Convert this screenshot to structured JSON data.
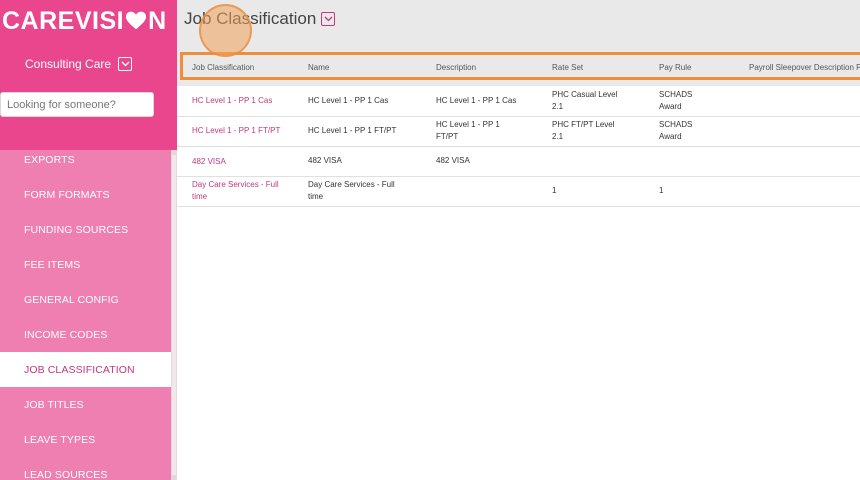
{
  "brand": {
    "logo_prefix": "CAREVISI",
    "logo_suffix": "N",
    "accent": "#e9468e",
    "link": "#c2387a",
    "highlight": "#ee8e3a"
  },
  "sidebar": {
    "org_name": "Consulting Care",
    "search_placeholder": "Looking for someone?",
    "items": [
      {
        "label": "EXPORTS"
      },
      {
        "label": "FORM FORMATS"
      },
      {
        "label": "FUNDING SOURCES"
      },
      {
        "label": "FEE ITEMS"
      },
      {
        "label": "GENERAL CONFIG"
      },
      {
        "label": "INCOME CODES"
      },
      {
        "label": "JOB CLASSIFICATION",
        "active": true
      },
      {
        "label": "JOB TITLES"
      },
      {
        "label": "LEAVE TYPES"
      },
      {
        "label": "LEAD SOURCES"
      }
    ]
  },
  "page": {
    "title": "Job Classification"
  },
  "table": {
    "columns": [
      "Job Classification",
      "Name",
      "Description",
      "Rate Set",
      "Pay Rule",
      "Payroll Sleepover Description Pr"
    ],
    "rows": [
      {
        "classification": [
          "HC Level 1 - PP 1 Cas"
        ],
        "name": [
          "HC Level 1 - PP 1 Cas"
        ],
        "description": [
          "HC Level 1 - PP 1 Cas"
        ],
        "rate_set": [
          "PHC Casual Level",
          "2.1"
        ],
        "pay_rule": [
          "SCHADS",
          "Award"
        ]
      },
      {
        "classification": [
          "HC Level 1 - PP 1 FT/PT"
        ],
        "name": [
          "HC Level 1 - PP 1 FT/PT"
        ],
        "description": [
          "HC Level 1 - PP 1",
          "FT/PT"
        ],
        "rate_set": [
          "PHC FT/PT Level",
          "2.1"
        ],
        "pay_rule": [
          "SCHADS",
          "Award"
        ]
      },
      {
        "classification": [
          "482 VISA"
        ],
        "name": [
          "482 VISA"
        ],
        "description": [
          "482 VISA"
        ],
        "rate_set": [],
        "pay_rule": []
      },
      {
        "classification": [
          "Day Care Services - Full",
          "time"
        ],
        "name": [
          "Day Care Services - Full",
          "time"
        ],
        "description": [],
        "rate_set": [
          "1"
        ],
        "pay_rule": [
          "1"
        ]
      }
    ]
  }
}
